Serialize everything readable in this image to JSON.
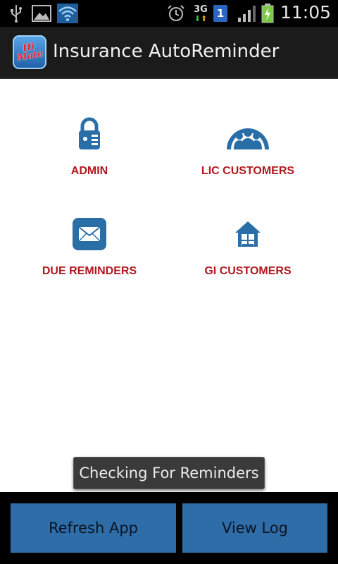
{
  "status_bar": {
    "time": "11:05",
    "network_type": "3G",
    "sim_slot": "1",
    "icons": [
      "usb-icon",
      "image-icon",
      "wifi-icon",
      "alarm-icon",
      "network-3g-icon",
      "sim-icon",
      "signal-icon",
      "battery-charging-icon"
    ]
  },
  "app_bar": {
    "logo_text": "Hi Mate",
    "title": "Insurance AutoReminder"
  },
  "menu": {
    "items": [
      {
        "label": "ADMIN",
        "icon": "lock-icon"
      },
      {
        "label": "LIC CUSTOMERS",
        "icon": "group-icon"
      },
      {
        "label": "DUE REMINDERS",
        "icon": "mail-icon"
      },
      {
        "label": "GI CUSTOMERS",
        "icon": "house-icon"
      }
    ]
  },
  "toast": {
    "message": "Checking For Reminders"
  },
  "bottom_buttons": {
    "refresh_label": "Refresh App",
    "view_log_label": "View Log"
  },
  "colors": {
    "accent_label": "#b2181e",
    "icon_blue": "#2a6ea8",
    "button_blue": "#2e6da8",
    "action_bar": "#1b1b1b"
  }
}
